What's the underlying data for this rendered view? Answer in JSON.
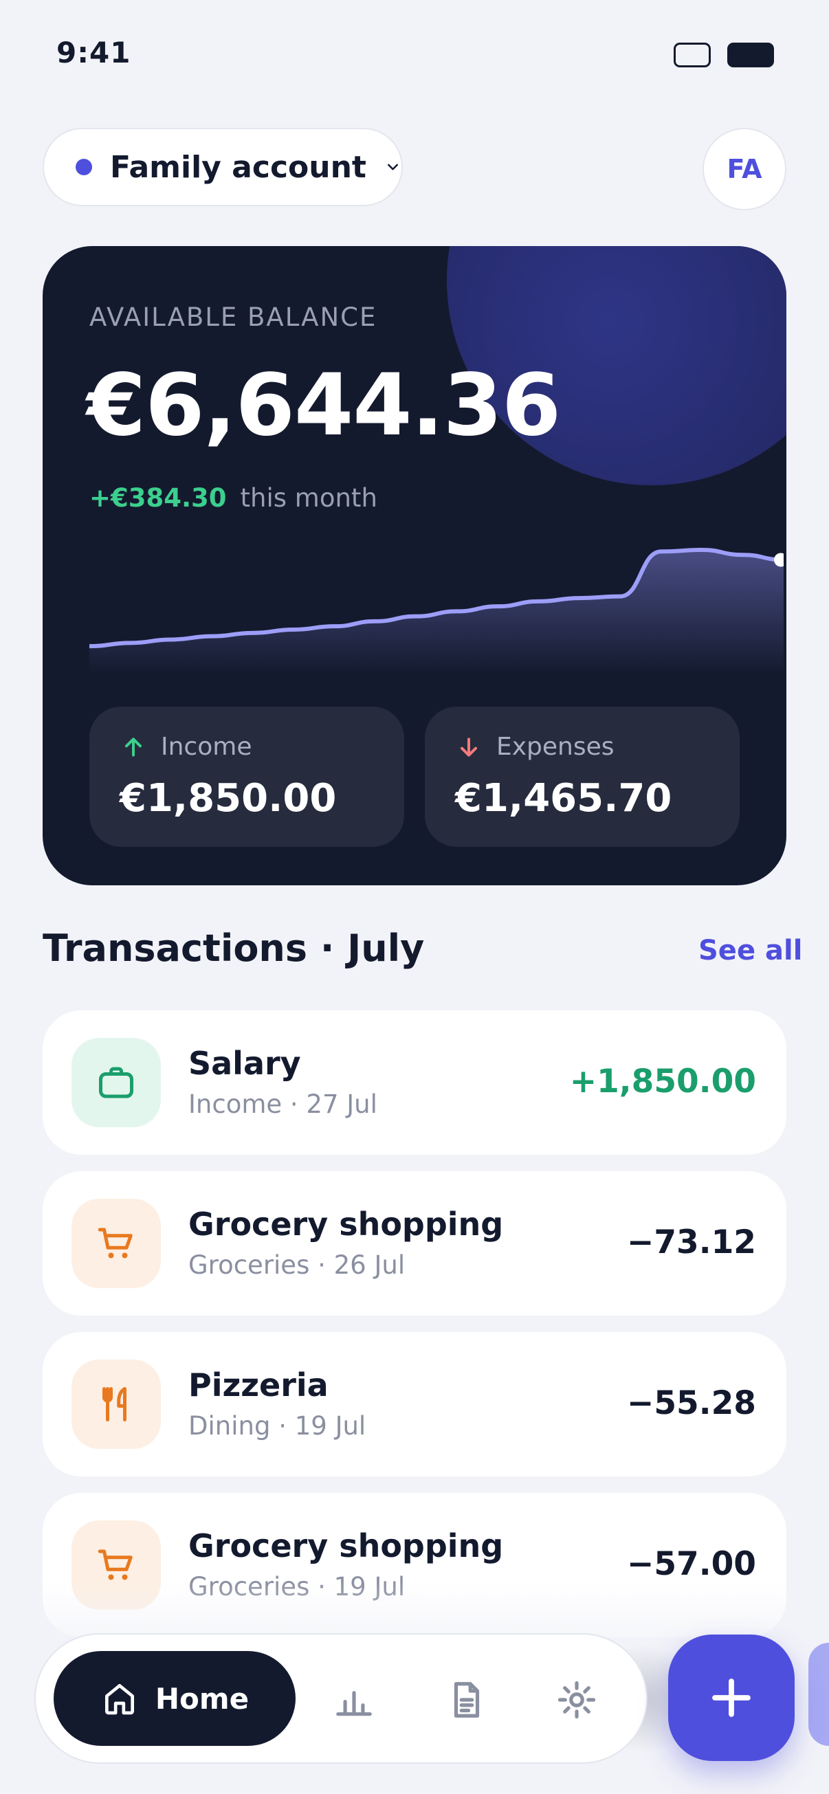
{
  "status_bar": {
    "time": "9:41"
  },
  "header": {
    "account_name": "Family account",
    "avatar_initials": "FA",
    "icons": {
      "account_dot": "status-dot",
      "chevron": "chevron-down-icon"
    }
  },
  "balance_card": {
    "label": "AVAILABLE BALANCE",
    "amount": "€6,644.36",
    "change_value": "+€384.30",
    "change_label": "this month",
    "trend": [
      0.42,
      0.44,
      0.46,
      0.48,
      0.5,
      0.52,
      0.54,
      0.57,
      0.6,
      0.63,
      0.66,
      0.69,
      0.71,
      0.72,
      0.99,
      1.0,
      0.97,
      0.94
    ],
    "income": {
      "label": "Income",
      "value": "€1,850.00",
      "icon": "arrow-up-icon"
    },
    "expenses": {
      "label": "Expenses",
      "value": "€1,465.70",
      "icon": "arrow-down-icon"
    }
  },
  "transactions": {
    "title": "Transactions · July",
    "see_all": "See all",
    "items": [
      {
        "name": "Salary",
        "meta": "Income · 27 Jul",
        "amount": "+1,850.00",
        "icon": "briefcase-icon",
        "icon_color": "#1a9e6c",
        "icon_bg": "#e3f6ee",
        "amount_color": "#1a9e6c"
      },
      {
        "name": "Grocery shopping",
        "meta": "Groceries · 26 Jul",
        "amount": "−73.12",
        "icon": "cart-icon",
        "icon_color": "#e8791f",
        "icon_bg": "#fdefe3",
        "amount_color": "#141a2e"
      },
      {
        "name": "Pizzeria",
        "meta": "Dining · 19 Jul",
        "amount": "−55.28",
        "icon": "utensils-icon",
        "icon_color": "#e8791f",
        "icon_bg": "#fdefe3",
        "amount_color": "#141a2e"
      },
      {
        "name": "Grocery shopping",
        "meta": "Groceries · 19 Jul",
        "amount": "−57.00",
        "icon": "cart-icon",
        "icon_color": "#e8791f",
        "icon_bg": "#fdefe3",
        "amount_color": "#141a2e"
      }
    ]
  },
  "bottom_nav": {
    "home_label": "Home",
    "items": [
      "home-icon",
      "chart-bars-icon",
      "document-icon",
      "settings-icon"
    ],
    "fab_icon": "plus-icon"
  },
  "colors": {
    "accent": "#4f4fdd",
    "dark": "#141a2e",
    "positive": "#1a9e6c",
    "background": "#f2f3f8"
  }
}
